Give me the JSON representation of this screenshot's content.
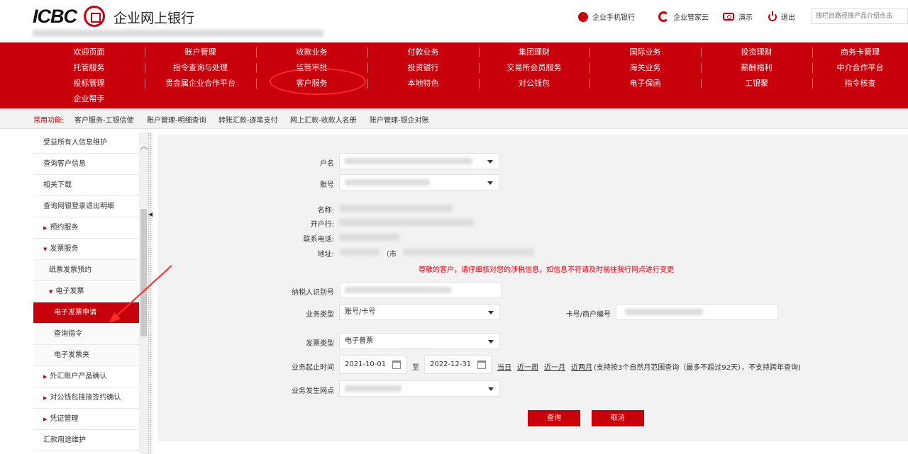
{
  "header": {
    "logo_text": "ICBC",
    "bank_name": "企业网上银行",
    "links": [
      "企业手机银行",
      "企业管家云",
      "演示",
      "退出"
    ],
    "search_placeholder": "搜栏目路径搜产品介绍点击"
  },
  "nav": {
    "rows": [
      [
        "欢迎页面",
        "账户管理",
        "收款业务",
        "付款业务",
        "集团理财",
        "国际业务",
        "投资理财",
        "商务卡管理"
      ],
      [
        "托管服务",
        "指令查询与处理",
        "监管审批",
        "投资银行",
        "交易所会员服务",
        "海关业务",
        "薪酬福利",
        "中介合作平台"
      ],
      [
        "投标管理",
        "贵金属企业合作平台",
        "客户服务",
        "本地特色",
        "对公钱包",
        "电子保函",
        "工银聚",
        "指令核查"
      ],
      [
        "企业帮手"
      ]
    ]
  },
  "quick": {
    "label": "常用功能:",
    "links": [
      "客户服务-工银信使",
      "账户管理-明细查询",
      "转账汇款-逐笔支付",
      "网上汇款-收款人名册",
      "账户管理-银企对账"
    ]
  },
  "sidebar": {
    "items": [
      {
        "label": "受益所有人信息维护",
        "level": 0,
        "caret": ""
      },
      {
        "label": "查询客户信息",
        "level": 0,
        "caret": ""
      },
      {
        "label": "相关下载",
        "level": 0,
        "caret": ""
      },
      {
        "label": "查询网银登录退出明细",
        "level": 0,
        "caret": ""
      },
      {
        "label": "预约服务",
        "level": 0,
        "caret": "▶"
      },
      {
        "label": "发票服务",
        "level": 0,
        "caret": "▼"
      },
      {
        "label": "纸票发票预约",
        "level": 1,
        "caret": ""
      },
      {
        "label": "电子发票",
        "level": 1,
        "caret": "▼"
      },
      {
        "label": "电子发票申请",
        "level": 2,
        "caret": "",
        "active": true
      },
      {
        "label": "查询指令",
        "level": 2,
        "caret": ""
      },
      {
        "label": "电子发票夹",
        "level": 2,
        "caret": ""
      },
      {
        "label": "外汇账户产品确认",
        "level": 0,
        "caret": "▶"
      },
      {
        "label": "对公钱包挂接签约确认",
        "level": 0,
        "caret": "▶"
      },
      {
        "label": "凭证管理",
        "level": 0,
        "caret": "▶"
      },
      {
        "label": "汇款用途维护",
        "level": 0,
        "caret": ""
      }
    ]
  },
  "form": {
    "account_name_label": "户名",
    "account_no_label": "账号",
    "name_label": "名称:",
    "bank_label": "开户行:",
    "phone_label": "联系电话:",
    "address_label": "地址:",
    "address_value_visible": "（市",
    "notice": "尊敬的客户，请仔细核对您的涉税信息，如信息不符请及时前往我行网点进行变更",
    "taxpayer_id_label": "纳税人识别号",
    "business_type_label": "业务类型",
    "business_type_value": "账号/卡号",
    "card_merchant_label": "卡号/商户编号",
    "invoice_type_label": "发票类型",
    "invoice_type_value": "电子普票",
    "period_label": "业务起止时间",
    "date_from": "2021-10-01",
    "date_to_sep": "至",
    "date_to": "2022-12-31",
    "quick_ranges": [
      "当日",
      "近一周",
      "近一月",
      "近两月"
    ],
    "range_hint": "(支持按3个自然月范围查询（最多不超过92天），不支持跨年查询)",
    "branch_label": "业务发生网点",
    "query_button": "查询",
    "cancel_button": "取消"
  },
  "colors": {
    "brand_red": "#c7000b",
    "notice_red": "#e60012",
    "annotation_red": "#ff2a2a"
  }
}
